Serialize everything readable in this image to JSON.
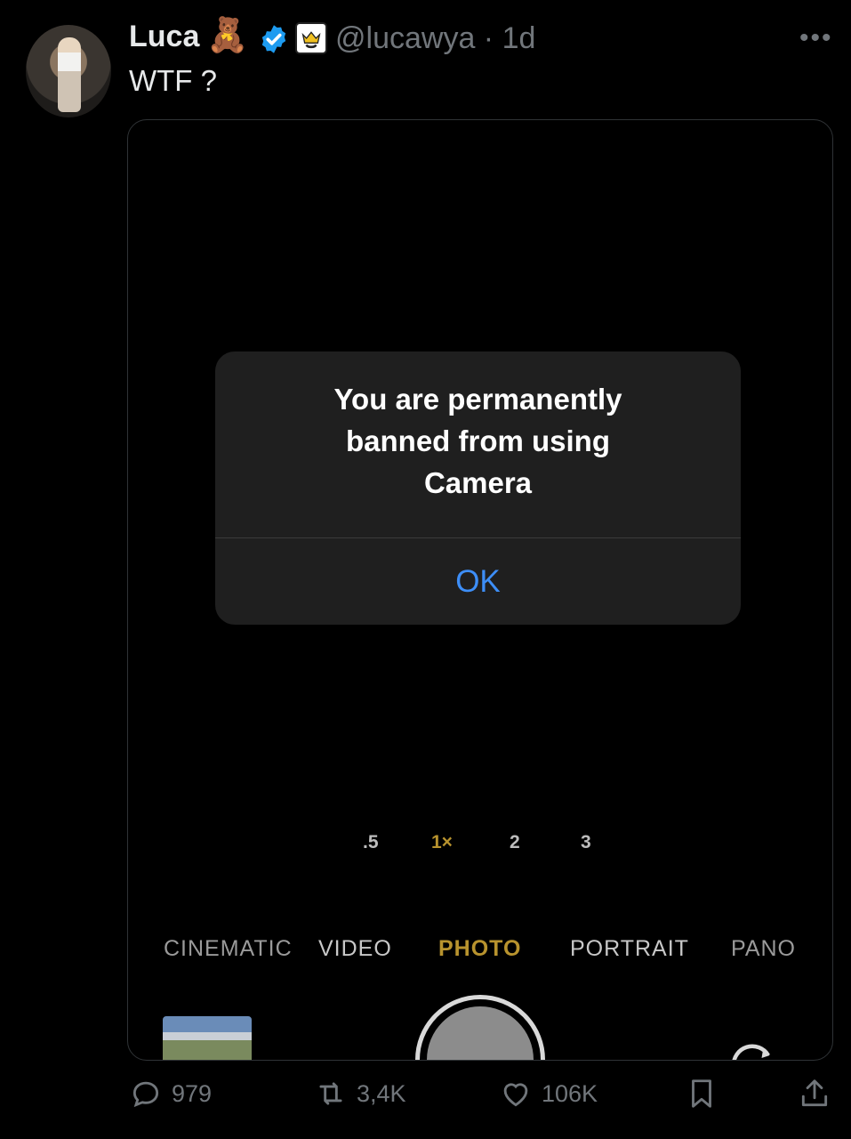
{
  "tweet": {
    "author_name": "Luca",
    "author_emoji": "🧸",
    "handle_time": "@lucawya · 1d",
    "text": "WTF ?",
    "more": "•••"
  },
  "media": {
    "alert": {
      "title": "You are permanently banned from using Camera",
      "button": "OK"
    },
    "zoom_levels": [
      ".5",
      "1×",
      "2",
      "3"
    ],
    "modes": [
      "CINEMATIC",
      "VIDEO",
      "PHOTO",
      "PORTRAIT",
      "PANO"
    ],
    "selected_mode": "PHOTO"
  },
  "actions": {
    "replies": "979",
    "reposts": "3,4K",
    "likes": "106K"
  },
  "colors": {
    "accent_blue": "#3d8ef7",
    "verified_blue": "#1d9bf0",
    "camera_yellow": "#b8932e",
    "muted": "#71767b"
  }
}
